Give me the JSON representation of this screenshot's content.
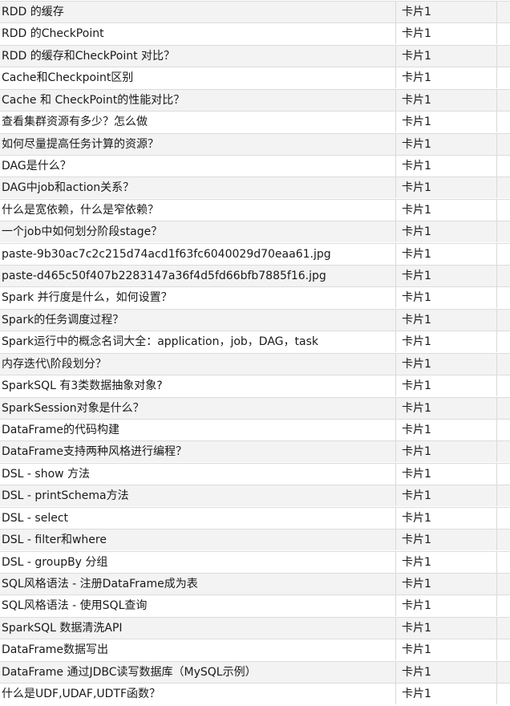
{
  "table": {
    "rows": [
      {
        "title": "RDD 的缓存",
        "type": "卡片1"
      },
      {
        "title": "RDD 的CheckPoint",
        "type": "卡片1"
      },
      {
        "title": "RDD 的缓存和CheckPoint 对比？",
        "type": "卡片1"
      },
      {
        "title": "Cache和Checkpoint区别",
        "type": "卡片1"
      },
      {
        "title": "Cache 和 CheckPoint的性能对比？",
        "type": "卡片1"
      },
      {
        "title": "查看集群资源有多少？怎么做",
        "type": "卡片1"
      },
      {
        "title": "如何尽量提高任务计算的资源？",
        "type": "卡片1"
      },
      {
        "title": "DAG是什么？",
        "type": "卡片1"
      },
      {
        "title": "DAG中job和action关系？",
        "type": "卡片1"
      },
      {
        "title": "什么是宽依赖，什么是窄依赖？",
        "type": "卡片1"
      },
      {
        "title": "一个job中如何划分阶段stage？",
        "type": "卡片1"
      },
      {
        "title": "paste-9b30ac7c2c215d74acd1f63fc6040029d70eaa61.jpg",
        "type": "卡片1"
      },
      {
        "title": "paste-d465c50f407b2283147a36f4d5fd66bfb7885f16.jpg",
        "type": "卡片1"
      },
      {
        "title": "Spark 并行度是什么，如何设置？",
        "type": "卡片1"
      },
      {
        "title": "Spark的任务调度过程？",
        "type": "卡片1"
      },
      {
        "title": "Spark运行中的概念名词大全：application，job，DAG，task",
        "type": "卡片1"
      },
      {
        "title": "内存迭代\\阶段划分？",
        "type": "卡片1"
      },
      {
        "title": "SparkSQL 有3类数据抽象对象?",
        "type": "卡片1"
      },
      {
        "title": "SparkSession对象是什么？",
        "type": "卡片1"
      },
      {
        "title": "DataFrame的代码构建",
        "type": "卡片1"
      },
      {
        "title": "DataFrame支持两种风格进行编程？",
        "type": "卡片1"
      },
      {
        "title": "DSL - show 方法",
        "type": "卡片1"
      },
      {
        "title": "DSL - printSchema方法",
        "type": "卡片1"
      },
      {
        "title": "DSL - select",
        "type": "卡片1"
      },
      {
        "title": "DSL - filter和where",
        "type": "卡片1"
      },
      {
        "title": "DSL - groupBy 分组",
        "type": "卡片1"
      },
      {
        "title": "SQL风格语法 - 注册DataFrame成为表",
        "type": "卡片1"
      },
      {
        "title": "SQL风格语法 - 使用SQL查询",
        "type": "卡片1"
      },
      {
        "title": "SparkSQL 数据清洗API",
        "type": "卡片1"
      },
      {
        "title": "DataFrame数据写出",
        "type": "卡片1"
      },
      {
        "title": "DataFrame 通过JDBC读写数据库（MySQL示例）",
        "type": "卡片1"
      },
      {
        "title": "什么是UDF,UDAF,UDTF函数？",
        "type": "卡片1"
      }
    ]
  }
}
